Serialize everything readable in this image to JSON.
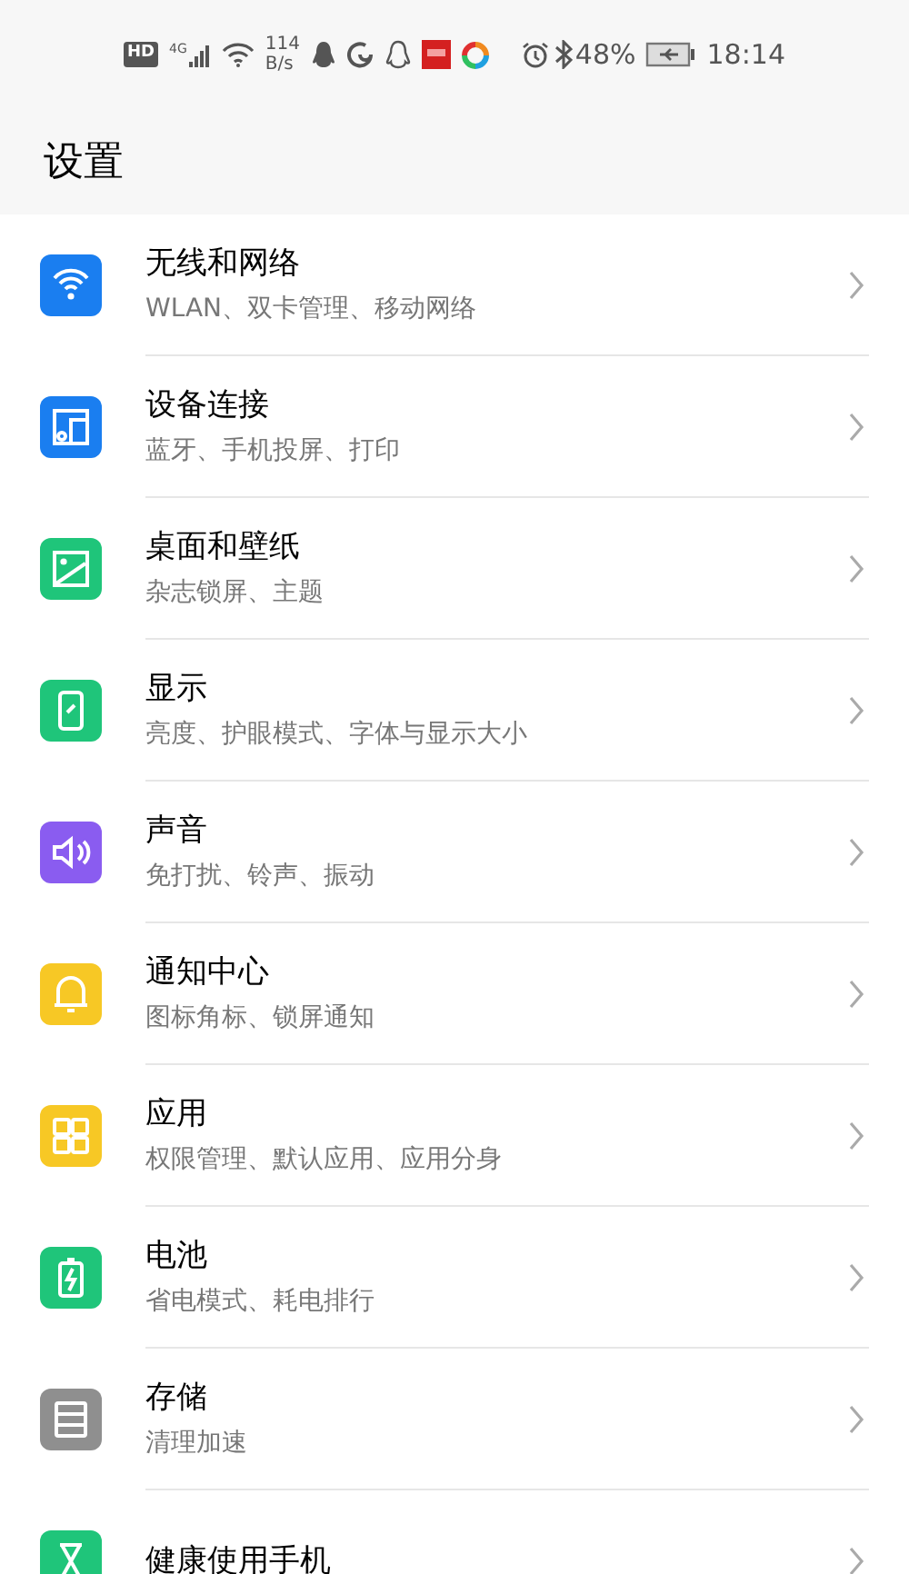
{
  "status_bar": {
    "hd": "HD",
    "network": "4G",
    "speed": "114",
    "speed_unit": "B/s",
    "battery": "48%",
    "time": "18:14"
  },
  "header": {
    "title": "设置"
  },
  "items": [
    {
      "title": "无线和网络",
      "subtitle": "WLAN、双卡管理、移动网络",
      "color": "#1a7ef0"
    },
    {
      "title": "设备连接",
      "subtitle": "蓝牙、手机投屏、打印",
      "color": "#1a7ef0"
    },
    {
      "title": "桌面和壁纸",
      "subtitle": "杂志锁屏、主题",
      "color": "#1fc57a"
    },
    {
      "title": "显示",
      "subtitle": "亮度、护眼模式、字体与显示大小",
      "color": "#1fc57a"
    },
    {
      "title": "声音",
      "subtitle": "免打扰、铃声、振动",
      "color": "#8a5cf0"
    },
    {
      "title": "通知中心",
      "subtitle": "图标角标、锁屏通知",
      "color": "#f7c825"
    },
    {
      "title": "应用",
      "subtitle": "权限管理、默认应用、应用分身",
      "color": "#f7c825"
    },
    {
      "title": "电池",
      "subtitle": "省电模式、耗电排行",
      "color": "#1fc57a"
    },
    {
      "title": "存储",
      "subtitle": "清理加速",
      "color": "#8f8f8f"
    },
    {
      "title": "健康使用手机",
      "color": "#1fc57a"
    }
  ]
}
